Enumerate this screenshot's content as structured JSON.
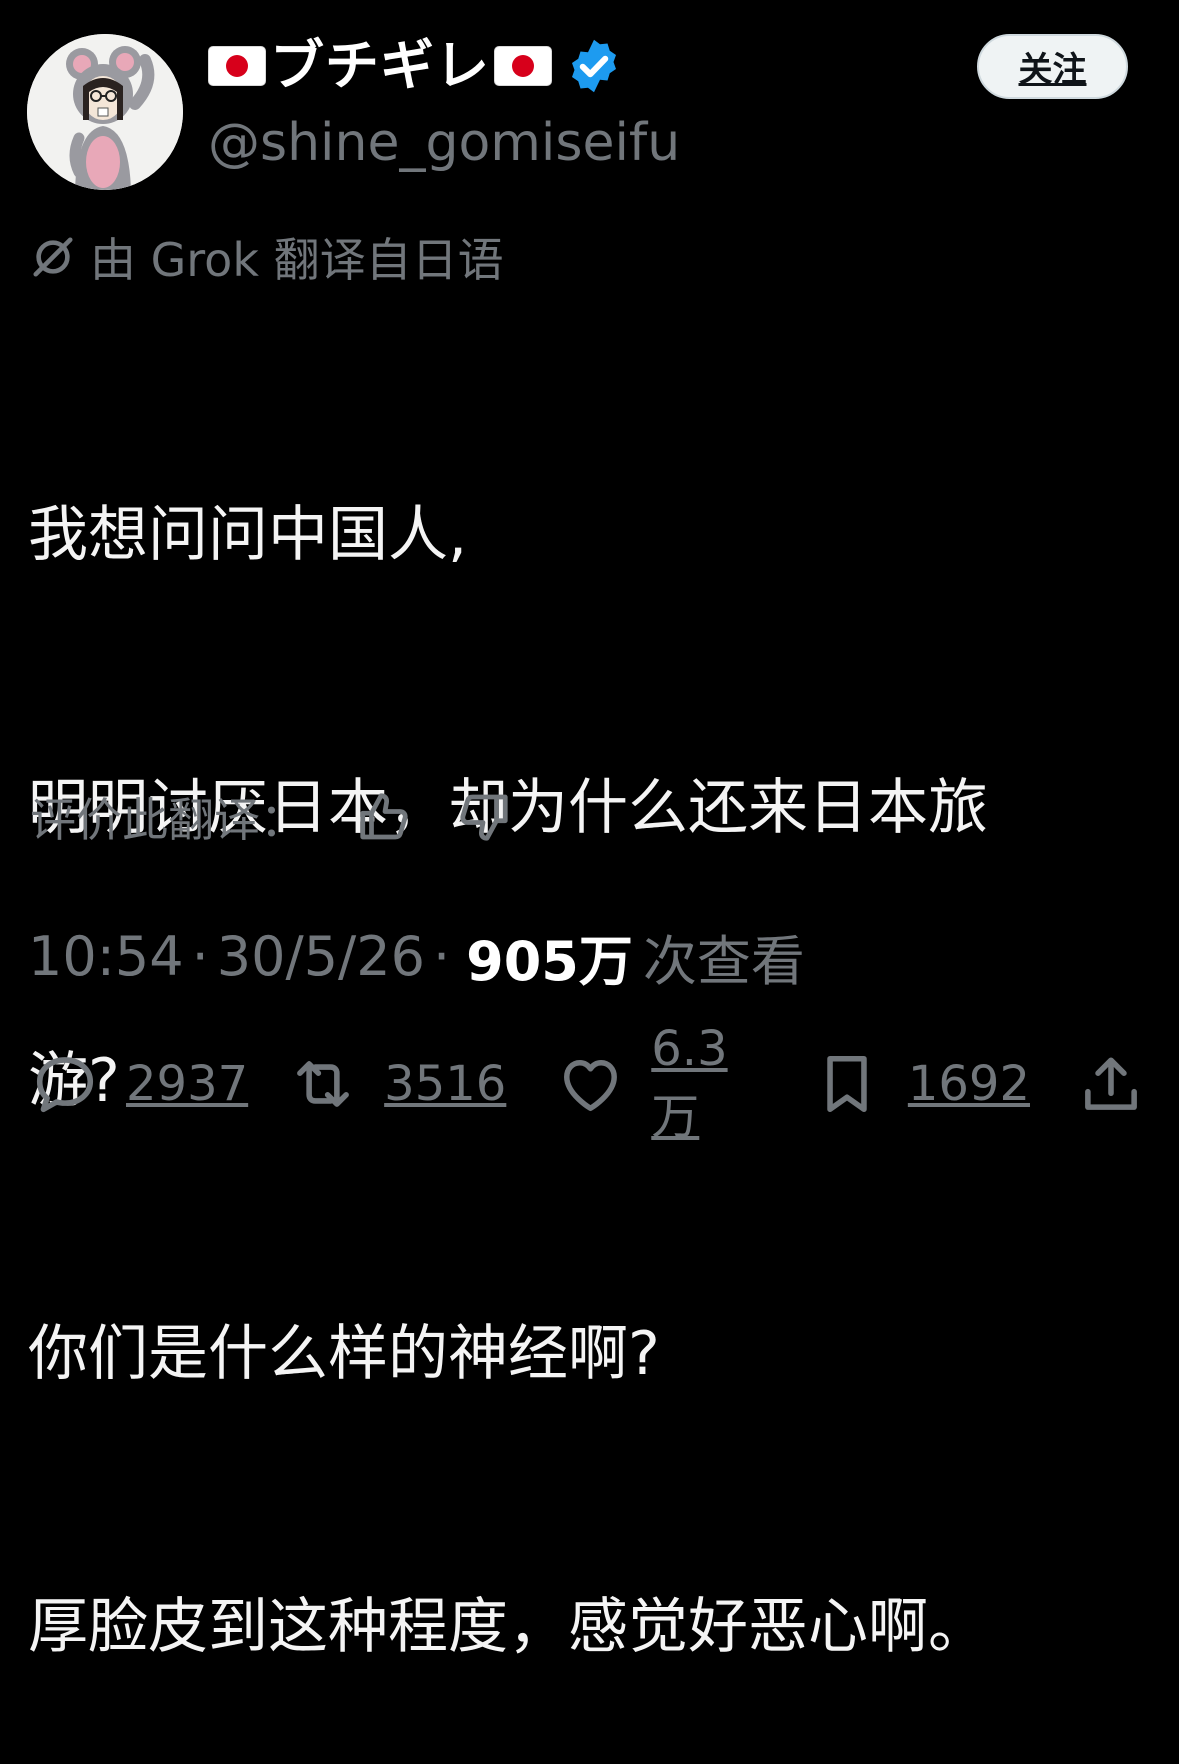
{
  "profile": {
    "display_name": "ブチギレ",
    "handle": "@shine_gomiseifu",
    "avatar_icon": "rat-costume-avatar",
    "flag_icon": "japan-flag",
    "verified_icon": "verified-badge-icon"
  },
  "follow_button": {
    "label": "关注"
  },
  "translation": {
    "icon": "grok-icon",
    "note": "由 Grok 翻译自日语",
    "rate_label": "评价此翻译："
  },
  "tweet": {
    "lines": [
      "我想问问中国人,",
      "明明讨厌日本，却为什么还来日本旅",
      "游?",
      "你们是什么样的神经啊?",
      "厚脸皮到这种程度，感觉好恶心啊。"
    ]
  },
  "meta": {
    "time": "10:54",
    "date": "30/5/26",
    "separator": "·",
    "views": "905万",
    "views_label": "次查看"
  },
  "actions": {
    "replies": "2937",
    "reposts": "3516",
    "likes": "6.3万",
    "bookmarks": "1692"
  },
  "colors": {
    "background": "#000000",
    "primary_text": "#f4f4f4",
    "secondary_text": "#71767b",
    "verified_blue": "#1d9bf0",
    "flag_red": "#d7001b"
  }
}
